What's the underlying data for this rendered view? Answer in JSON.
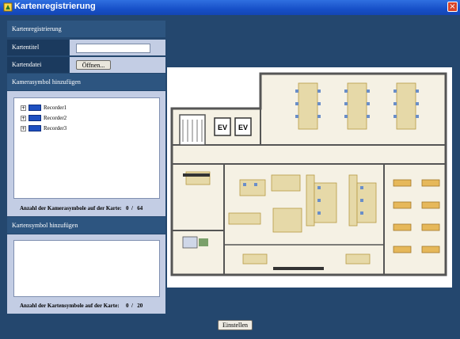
{
  "window": {
    "title": "Kartenregistrierung",
    "close": "×"
  },
  "section_header": "Kartenregistrierung",
  "form": {
    "map_title_label": "Kartentitel",
    "map_title_value": "",
    "map_file_label": "Kartendatei",
    "open_button": "Öffnen..."
  },
  "camera_section": {
    "header": "Kamerasymbol hinzufügen",
    "items": [
      {
        "expander": "+",
        "label": "Recorder1"
      },
      {
        "expander": "+",
        "label": "Recorder2"
      },
      {
        "expander": "+",
        "label": "Recorder3"
      }
    ],
    "count_label": "Anzahl der Kamerasymbole auf der Karte:",
    "count_current": "0",
    "count_sep": "/",
    "count_max": "64"
  },
  "map_symbol_section": {
    "header": "Kartensymbol hinzufügen",
    "count_label": "Anzahl der Kartensymbole auf der Karte:",
    "count_current": "0",
    "count_sep": "/",
    "count_max": "20"
  },
  "floorplan": {
    "elevator_labels": [
      "EV",
      "EV"
    ]
  },
  "apply_button": "Einstellen",
  "colors": {
    "titlebar": "#1750c8",
    "background": "#24476e",
    "panel": "#c3cde4",
    "section": "#2d5580"
  }
}
